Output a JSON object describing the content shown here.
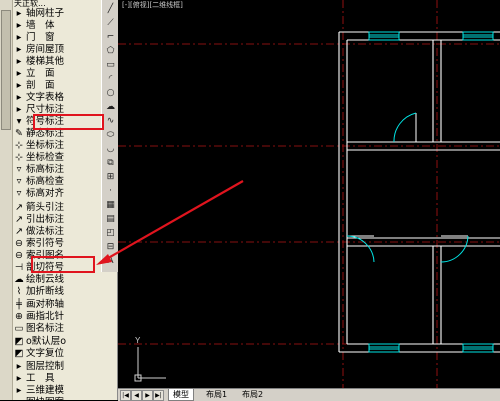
{
  "palette": {
    "header": "天正软...",
    "items": [
      {
        "label": "轴网柱子",
        "icon": "triangle-right-icon",
        "glyph": "▸"
      },
      {
        "label": "墙　体",
        "icon": "triangle-right-icon",
        "glyph": "▸"
      },
      {
        "label": "门　窗",
        "icon": "triangle-right-icon",
        "glyph": "▸"
      },
      {
        "label": "房间屋顶",
        "icon": "triangle-right-icon",
        "glyph": "▸"
      },
      {
        "label": "楼梯其他",
        "icon": "triangle-right-icon",
        "glyph": "▸"
      },
      {
        "label": "立　面",
        "icon": "triangle-right-icon",
        "glyph": "▸"
      },
      {
        "label": "剖　面",
        "icon": "triangle-right-icon",
        "glyph": "▸"
      },
      {
        "label": "文字表格",
        "icon": "triangle-right-icon",
        "glyph": "▸"
      },
      {
        "label": "尺寸标注",
        "icon": "triangle-right-icon",
        "glyph": "▸"
      },
      {
        "label": "符号标注",
        "icon": "triangle-down-icon",
        "glyph": "▾"
      },
      {
        "label": "静态标注",
        "icon": "static-annotation-icon",
        "glyph": "✎"
      },
      {
        "label": "坐标标注",
        "icon": "coordinate-annotation-icon",
        "glyph": "⊹"
      },
      {
        "label": "坐标检查",
        "icon": "coordinate-check-icon",
        "glyph": "⊹"
      },
      {
        "label": "标高标注",
        "icon": "elevation-annotation-icon",
        "glyph": "▿"
      },
      {
        "label": "标高检查",
        "icon": "elevation-check-icon",
        "glyph": "▿"
      },
      {
        "label": "标高对齐",
        "icon": "elevation-align-icon",
        "glyph": "▿"
      },
      {
        "label": "箭头引注",
        "icon": "arrow-leader-icon",
        "glyph": "↗"
      },
      {
        "label": "引出标注",
        "icon": "leader-annotation-icon",
        "glyph": "↗"
      },
      {
        "label": "做法标注",
        "icon": "method-annotation-icon",
        "glyph": "↗"
      },
      {
        "label": "索引符号",
        "icon": "index-symbol-icon",
        "glyph": "⊖"
      },
      {
        "label": "索引图名",
        "icon": "index-title-icon",
        "glyph": "⊖"
      },
      {
        "label": "剖切符号",
        "icon": "section-symbol-icon",
        "glyph": "⊣"
      },
      {
        "label": "绘制云线",
        "icon": "revision-cloud-icon",
        "glyph": "☁"
      },
      {
        "label": "加折断线",
        "icon": "break-line-icon",
        "glyph": "⌇"
      },
      {
        "label": "画对称轴",
        "icon": "symmetry-axis-icon",
        "glyph": "╪"
      },
      {
        "label": "画指北针",
        "icon": "north-arrow-icon",
        "glyph": "⊕"
      },
      {
        "label": "图名标注",
        "icon": "drawing-title-icon",
        "glyph": "▭"
      },
      {
        "label": "o默认层o",
        "icon": "default-layer-icon",
        "glyph": "◩"
      },
      {
        "label": "文字复位",
        "icon": "text-reset-icon",
        "glyph": "◩"
      },
      {
        "label": "图层控制",
        "icon": "triangle-right-icon",
        "glyph": "▸"
      },
      {
        "label": "工　具",
        "icon": "triangle-right-icon",
        "glyph": "▸"
      },
      {
        "label": "三维建模",
        "icon": "triangle-right-icon",
        "glyph": "▸"
      },
      {
        "label": "图块图案",
        "icon": "triangle-right-icon",
        "glyph": "▸"
      }
    ]
  },
  "canvas": {
    "viewport_label": "[-][俯视][二维线框]"
  },
  "tabs": {
    "items": [
      "模型",
      "布局1",
      "布局2"
    ],
    "active": "模型",
    "nav": [
      "|◀",
      "◀",
      "▶",
      "▶|"
    ]
  },
  "colors": {
    "wall": "#ffffff",
    "axis": "#ff0000",
    "window": "#00e5e5",
    "door": "#00e5e5",
    "annotation": "#e0141e",
    "grid": "#2a2a2a"
  }
}
